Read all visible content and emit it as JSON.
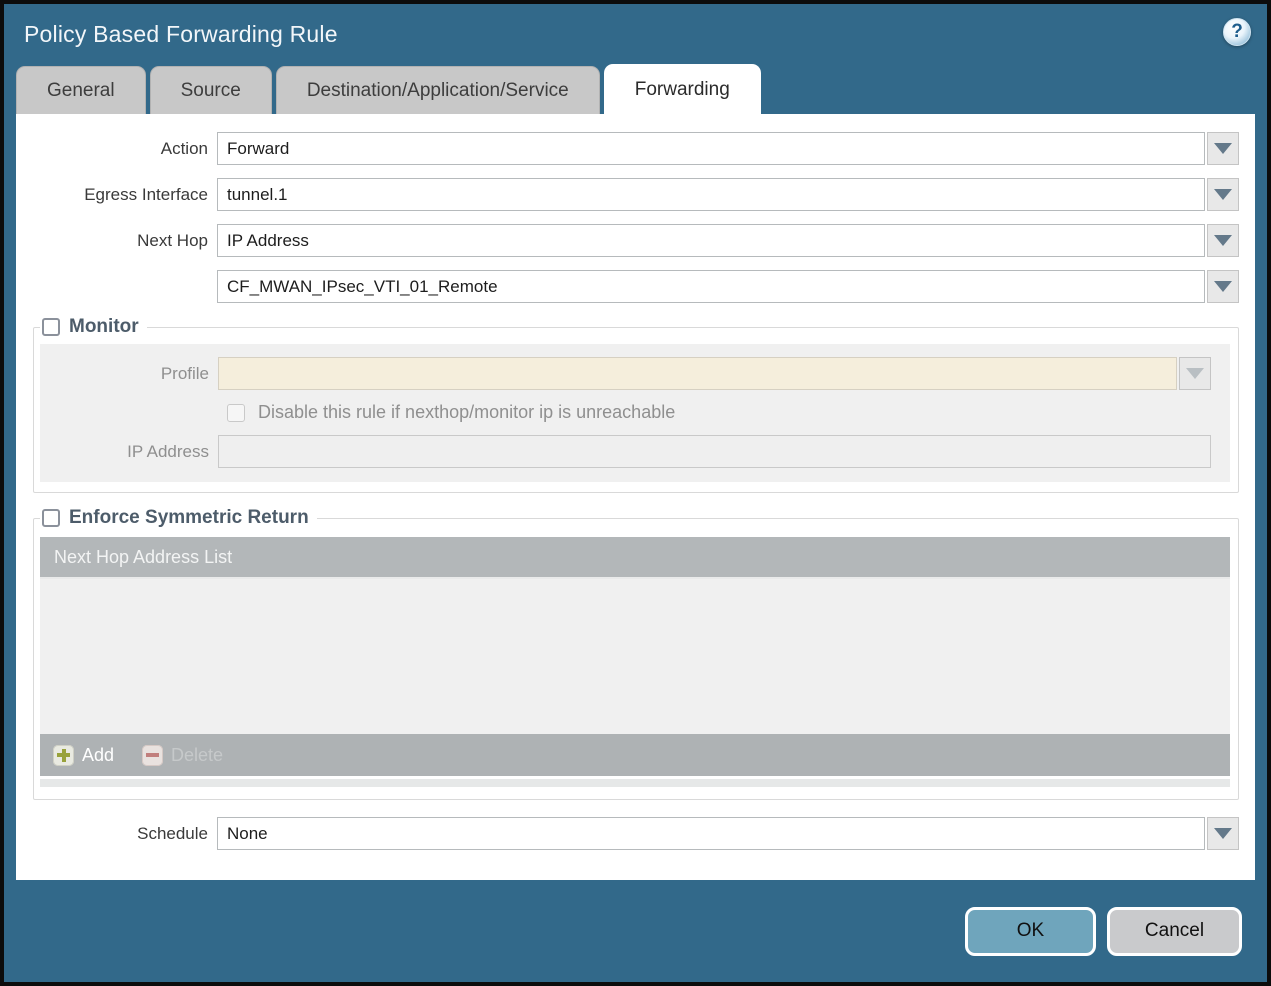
{
  "window": {
    "title": "Policy Based Forwarding Rule"
  },
  "tabs": [
    {
      "label": "General"
    },
    {
      "label": "Source"
    },
    {
      "label": "Destination/Application/Service"
    },
    {
      "label": "Forwarding"
    }
  ],
  "form": {
    "action": {
      "label": "Action",
      "value": "Forward"
    },
    "egress_interface": {
      "label": "Egress Interface",
      "value": "tunnel.1"
    },
    "next_hop": {
      "label": "Next Hop",
      "value": "IP Address"
    },
    "next_hop_address": {
      "value": "CF_MWAN_IPsec_VTI_01_Remote"
    },
    "schedule": {
      "label": "Schedule",
      "value": "None"
    }
  },
  "monitor": {
    "legend": "Monitor",
    "profile_label": "Profile",
    "profile_value": "",
    "disable_rule_label": "Disable this rule if nexthop/monitor ip is unreachable",
    "ip_label": "IP Address",
    "ip_value": ""
  },
  "enforce": {
    "legend": "Enforce Symmetric Return",
    "table_header": "Next Hop Address List",
    "add_label": "Add",
    "delete_label": "Delete"
  },
  "buttons": {
    "ok": "OK",
    "cancel": "Cancel"
  },
  "icons": {
    "help": "?"
  },
  "colors": {
    "window_teal": "#32698a",
    "tab_inactive": "#c8c8c8",
    "active_tab": "#ffffff",
    "disabled_field_beige": "#f5eedc",
    "table_header_gray": "#b3b7b9",
    "ok_button": "#6fa5bc",
    "cancel_button": "#c9cacc",
    "add_plus_green": "#98a23b",
    "delete_minus_red": "#c17f7d"
  }
}
